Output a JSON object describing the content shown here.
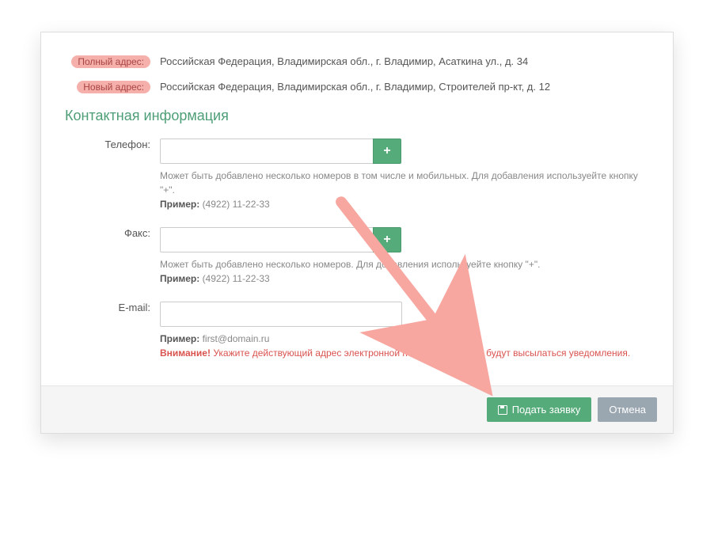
{
  "addresses": {
    "full_label": "Полный адрес:",
    "full_value": "Российская Федерация, Владимирская обл., г. Владимир, Асаткина ул., д. 34",
    "new_label": "Новый адрес:",
    "new_value": "Российская Федерация, Владимирская обл., г. Владимир, Строителей пр-кт, д. 12"
  },
  "section_title": "Контактная информация",
  "phone": {
    "label": "Телефон:",
    "value": "",
    "add_icon": "+",
    "help": "Может быть добавлено несколько номеров в том числе и мобильных. Для добавления используейте кнопку \"+\".",
    "example_label": "Пример:",
    "example_value": "(4922) 11-22-33"
  },
  "fax": {
    "label": "Факс:",
    "value": "",
    "add_icon": "+",
    "help": "Может быть добавлено несколько номеров. Для добавления используейте кнопку \"+\".",
    "example_label": "Пример:",
    "example_value": "(4922) 11-22-33"
  },
  "email": {
    "label": "E-mail:",
    "value": "",
    "example_label": "Пример:",
    "example_value": "first@domain.ru",
    "warn_label": "Внимание!",
    "warn_text": "Укажите действующий адрес электронной почты, на который будут высылаться уведомления."
  },
  "footer": {
    "submit": "Подать заявку",
    "cancel": "Отмена"
  }
}
